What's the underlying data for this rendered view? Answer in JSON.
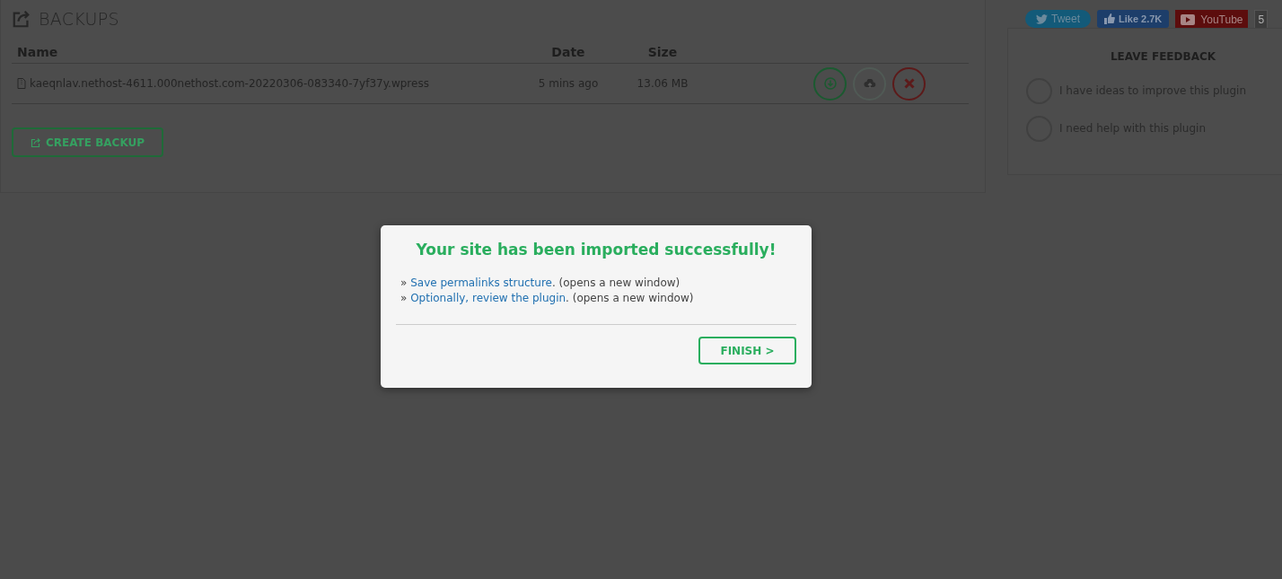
{
  "backups": {
    "title": "BACKUPS",
    "columns": [
      "Name",
      "Date",
      "Size"
    ],
    "rows": [
      {
        "name": "kaeqnlav.nethost-4611.000nethost.com-20220306-083340-7yf37y.wpress",
        "date": "5 mins ago",
        "size": "13.06 MB"
      }
    ],
    "create_button": "CREATE BACKUP"
  },
  "social": {
    "tweet": "Tweet",
    "like": "Like 2.7K",
    "youtube": "YouTube",
    "youtube_count": "5"
  },
  "feedback": {
    "title": "LEAVE FEEDBACK",
    "options": [
      {
        "label": "I have ideas to improve this plugin",
        "selected": false
      },
      {
        "label": "I need help with this plugin",
        "selected": false
      }
    ]
  },
  "dialog": {
    "title": "Your site has been imported successfully!",
    "lines": [
      {
        "prefix": "»",
        "link": "Save permalinks structure",
        "suffix": ". (opens a new window)"
      },
      {
        "prefix": "»",
        "link": "Optionally, review the plugin",
        "suffix": ". (opens a new window)"
      }
    ],
    "button": "FINISH >"
  }
}
